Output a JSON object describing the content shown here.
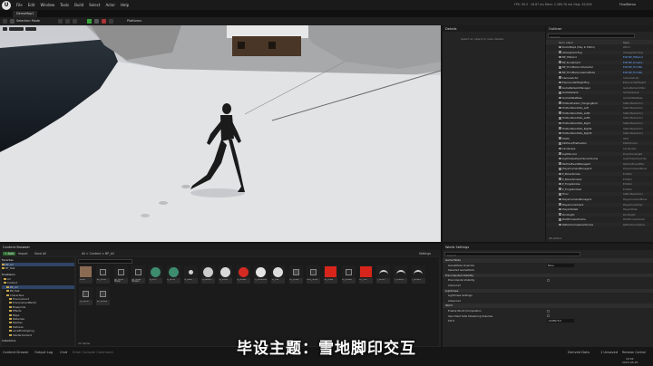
{
  "menubar": {
    "logo": "U",
    "items": [
      "File",
      "Edit",
      "Window",
      "Tools",
      "Build",
      "Select",
      "Actor",
      "Help"
    ],
    "stats": "FPS: 59.3  ·  16.87 ms   Mem: 2,389.76 mb   Objs: 49,506",
    "project": "FinalDemo"
  },
  "tabs": {
    "level": "DemoMap1"
  },
  "toolbar": {
    "mode": "Selection Mode",
    "platforms": "Platforms"
  },
  "details": {
    "title": "Details",
    "empty_hint": "Select an object to view details."
  },
  "outliner": {
    "title": "Outliner",
    "search_placeholder": "Search",
    "col_label": "Item Label",
    "col_type": "Type",
    "rows": [
      {
        "name": "DemoMap1 (Play In Editor)",
        "type": "World"
      },
      {
        "name": "AtmosphericFog",
        "type": "AtmosphericFog"
      },
      {
        "name": "BP_Hiltwind",
        "type": "Edit BP_Hiltwind"
      },
      {
        "name": "BP_Snowboard",
        "type": "Edit BP_Snowbo"
      },
      {
        "name": "BP_ThirdPersonCharacter",
        "type": "Edit BP_ThirdPe"
      },
      {
        "name": "BP_ThirdPersonGameMode",
        "type": "Edit BP_ThirdPe"
      },
      {
        "name": "CameraActor",
        "type": "CameraActor"
      },
      {
        "name": "ExponentialHeightFog",
        "type": "ExponentialHeight"
      },
      {
        "name": "GameNetworkManager",
        "type": "GameNetworkMan"
      },
      {
        "name": "GameSession",
        "type": "GameSession"
      },
      {
        "name": "GameStateBase",
        "type": "GameStateBase"
      },
      {
        "name": "HiddenPosition_HangingRock",
        "type": "StaticMeshActor"
      },
      {
        "name": "HiddenWoodSills_Left",
        "type": "StaticMeshActor"
      },
      {
        "name": "HiddenWoodSills_Left2",
        "type": "StaticMeshActor"
      },
      {
        "name": "HiddenWoodSills_Left3",
        "type": "StaticMeshActor"
      },
      {
        "name": "HiddenWoodSills_Right",
        "type": "StaticMeshActor"
      },
      {
        "name": "HiddenWoodSills_Right2",
        "type": "StaticMeshActor"
      },
      {
        "name": "HiddenWoodSills_Right3",
        "type": "StaticMeshActor"
      },
      {
        "name": "HUD0",
        "type": "HUD"
      },
      {
        "name": "KillZone/FirePosition",
        "type": "KillZVolume"
      },
      {
        "name": "Landscape",
        "type": "Landscape"
      },
      {
        "name": "LightSource",
        "type": "DirectionalLight"
      },
      {
        "name": "LightmassImportanceVolume",
        "type": "LightmassImportan"
      },
      {
        "name": "ParticleEventManager0",
        "type": "ParticleEventMan"
      },
      {
        "name": "PlayerCameraManager0",
        "type": "PlayerCameraMana"
      },
      {
        "name": "P_BoilerSmoke",
        "type": "Emitter"
      },
      {
        "name": "P_BoilerSmoke2",
        "type": "Emitter"
      },
      {
        "name": "P_ForgeSmoke",
        "type": "Emitter"
      },
      {
        "name": "P_ForgeSmoke2",
        "type": "Emitter"
      },
      {
        "name": "Floor",
        "type": "StaticMeshActor"
      },
      {
        "name": "PlayerCameraManager1",
        "type": "PlayerCameraMana"
      },
      {
        "name": "PlayerController0",
        "type": "PlayerController"
      },
      {
        "name": "PlayerState0",
        "type": "PlayerState"
      },
      {
        "name": "PointLight",
        "type": "PointLight"
      },
      {
        "name": "PostProcessVolume",
        "type": "PostProcessVolum"
      },
      {
        "name": "ReflectionCaptureVolume",
        "type": "ReflectionCapture"
      }
    ],
    "footer": "44 actors"
  },
  "content_browser": {
    "title": "Content Browser",
    "add": "+ Add",
    "import": "Import",
    "save_all": "Save All",
    "path": "All  >  Content  >  BP_All",
    "settings": "Settings",
    "favorites_title": "Favorites",
    "favorites": [
      "BP_All",
      "RT_Test"
    ],
    "project_title": "FinalDemo",
    "tree": [
      "All",
      "Content",
      "BP_All",
      "BP_Test",
      "Characters",
      "Environment",
      "EnvironmentPack2",
      "Blueprints",
      "Effects",
      "Maps",
      "Materials",
      "Meshes",
      "Textures",
      "LevelPrototyping",
      "StarterContent"
    ],
    "collections": "Collections",
    "item_count": "22 items",
    "assets": [
      {
        "label": "Decal",
        "thumb": "#8a6a53",
        "shape": "box"
      },
      {
        "label": "BP_Show",
        "thumb": "#2a2a2a",
        "shape": "icon"
      },
      {
        "label": "BP_Show Mover",
        "thumb": "#2a2a2a",
        "shape": "icon"
      },
      {
        "label": "BP_Show Mover2",
        "thumb": "#2a2a2a",
        "shape": "icon"
      },
      {
        "label": "M_Grid",
        "thumb": "#3e8c6e",
        "shape": "sphere"
      },
      {
        "label": "M_Grid2",
        "thumb": "#3e8c6e",
        "shape": "sphere"
      },
      {
        "label": "M_Mesh",
        "thumb": "#2a2a2a",
        "shape": "dot"
      },
      {
        "label": "M_Pattern",
        "thumb": "#cccccc",
        "shape": "sphere"
      },
      {
        "label": "M_Snow",
        "thumb": "#d9d9d9",
        "shape": "sphere"
      },
      {
        "label": "M_Snow2",
        "thumb": "#d32b22",
        "shape": "sphere"
      },
      {
        "label": "M_SnowTrail",
        "thumb": "#e5e5e5",
        "shape": "sphere"
      },
      {
        "label": "M_Trail",
        "thumb": "#dddddd",
        "shape": "sphere"
      },
      {
        "label": "MF_Brush",
        "thumb": "#444444",
        "shape": "icon"
      },
      {
        "label": "MPC_Snow",
        "thumb": "#333333",
        "shape": "icon"
      },
      {
        "label": "RT_Draw",
        "thumb": "#d7251b",
        "shape": "box"
      },
      {
        "label": "RT_Draw2",
        "thumb": "#2a2a2a",
        "shape": "icon"
      },
      {
        "label": "RT_Trail",
        "thumb": "#d7251b",
        "shape": "box"
      },
      {
        "label": "T_Brush",
        "thumb": "#2a2a2a",
        "shape": "arc"
      },
      {
        "label": "T_Brush2",
        "thumb": "#2a2a2a",
        "shape": "arc"
      },
      {
        "label": "T_Brush3",
        "thumb": "#2a2a2a",
        "shape": "arc"
      },
      {
        "label": "BP_Decal",
        "thumb": "#3a3a3a",
        "shape": "icon"
      },
      {
        "label": "BP_Decal2",
        "thumb": "#3a3a3a",
        "shape": "icon"
      }
    ]
  },
  "world_settings": {
    "title": "World Settings",
    "search_placeholder": "Search",
    "rows": [
      {
        "label": "Game Mode",
        "kind": "sec"
      },
      {
        "label": "GameMode Override",
        "kind": "val",
        "value": "None"
      },
      {
        "label": "Selected GameMode",
        "kind": "plain"
      },
      {
        "label": "Precomputed Visibility",
        "kind": "sec"
      },
      {
        "label": "Precompute Visibility",
        "kind": "chk"
      },
      {
        "label": "Advanced",
        "kind": "plain"
      },
      {
        "label": "Lightmass",
        "kind": "sec"
      },
      {
        "label": "Lightmass Settings",
        "kind": "plain"
      },
      {
        "label": "Advanced",
        "kind": "plain"
      },
      {
        "label": "World",
        "kind": "sec"
      },
      {
        "label": "Enable World Composition",
        "kind": "chk"
      },
      {
        "label": "Use Client Side Streaming Volumes",
        "kind": "chk"
      },
      {
        "label": "Kill Z",
        "kind": "val",
        "value": "-1048575.0"
      }
    ]
  },
  "statusbar": {
    "content_drawer": "Content Drawer",
    "output_log": "Output Log",
    "cmd": "Cmd",
    "console_placeholder": "Enter Console Command",
    "derived_data": "Derived Data",
    "unsaved": "1 Unsaved",
    "revision": "Revision Control",
    "clock": "19:02",
    "date": "2023-05-20"
  },
  "subtitle": "毕设主题：雪地脚印交互"
}
